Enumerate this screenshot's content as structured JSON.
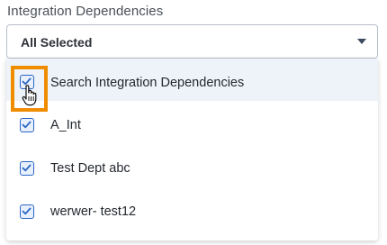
{
  "field": {
    "label": "Integration Dependencies",
    "selected_value": "All Selected",
    "caret_icon": "caret-down-icon"
  },
  "dropdown": {
    "options": [
      {
        "label": "Search Integration Dependencies",
        "checked": true,
        "hovered": true
      },
      {
        "label": "A_Int",
        "checked": true,
        "hovered": false
      },
      {
        "label": "Test Dept abc",
        "checked": true,
        "hovered": false
      },
      {
        "label": "werwer- test12",
        "checked": true,
        "hovered": false
      }
    ]
  },
  "colors": {
    "checkbox_accent": "#2b66c6",
    "highlight_border": "#f08c00",
    "hover_row": "#eef3fa"
  },
  "cursor_icon": "hand-pointer-icon"
}
